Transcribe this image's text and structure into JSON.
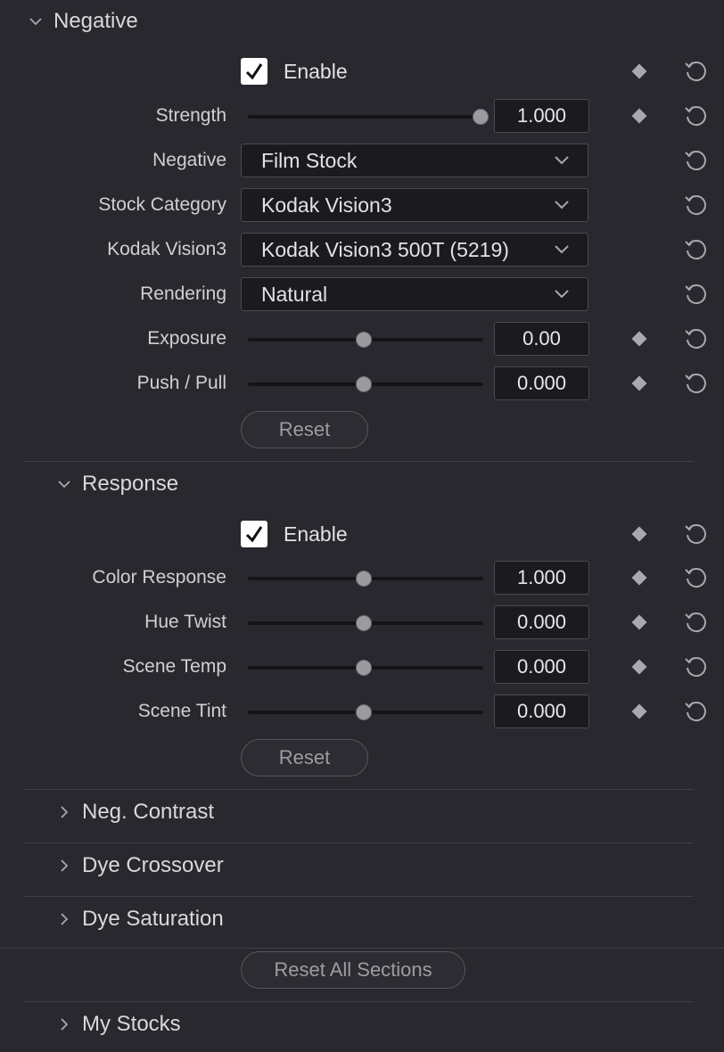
{
  "negative": {
    "title": "Negative",
    "enable_label": "Enable",
    "rows": {
      "strength": {
        "label": "Strength",
        "value": "1.000",
        "position": 1.0
      },
      "negative": {
        "label": "Negative",
        "value": "Film Stock"
      },
      "stock_category": {
        "label": "Stock Category",
        "value": "Kodak Vision3"
      },
      "kodak_vision3": {
        "label": "Kodak Vision3",
        "value": "Kodak Vision3 500T (5219)"
      },
      "rendering": {
        "label": "Rendering",
        "value": "Natural"
      },
      "exposure": {
        "label": "Exposure",
        "value": "0.00",
        "position": 0.5
      },
      "push_pull": {
        "label": "Push / Pull",
        "value": "0.000",
        "position": 0.5
      }
    },
    "reset_label": "Reset"
  },
  "response": {
    "title": "Response",
    "enable_label": "Enable",
    "rows": {
      "color_response": {
        "label": "Color Response",
        "value": "1.000",
        "position": 0.5
      },
      "hue_twist": {
        "label": "Hue Twist",
        "value": "0.000",
        "position": 0.5
      },
      "scene_temp": {
        "label": "Scene Temp",
        "value": "0.000",
        "position": 0.5
      },
      "scene_tint": {
        "label": "Scene Tint",
        "value": "0.000",
        "position": 0.5
      }
    },
    "reset_label": "Reset"
  },
  "collapsed_sections": [
    "Neg. Contrast",
    "Dye Crossover",
    "Dye Saturation"
  ],
  "reset_all_label": "Reset All Sections",
  "my_stocks": "My Stocks"
}
